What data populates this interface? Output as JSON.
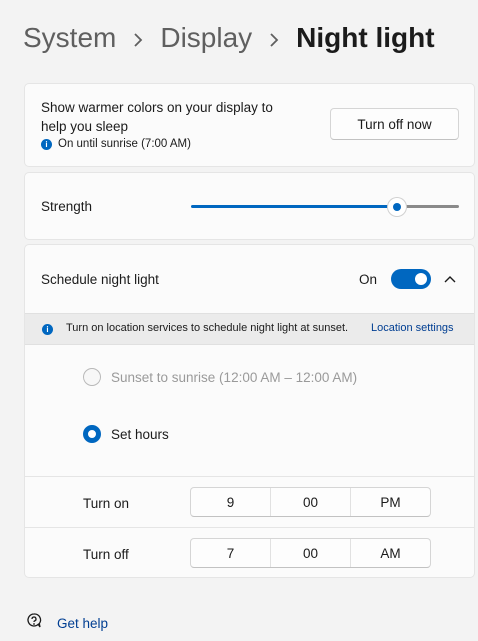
{
  "breadcrumb": {
    "items": [
      "System",
      "Display"
    ],
    "current": "Night light"
  },
  "night_light": {
    "description": "Show warmer colors on your display to help you sleep",
    "status": "On until sunrise (7:00 AM)",
    "button_label": "Turn off now"
  },
  "strength": {
    "label": "Strength",
    "value_fraction": 0.77
  },
  "schedule": {
    "label": "Schedule night light",
    "toggle_state": "On",
    "banner_text": "Turn on location services to schedule night light at sunset.",
    "banner_link": "Location settings",
    "option_sunset": "Sunset to sunrise (12:00 AM – 12:00 AM)",
    "option_set_hours": "Set hours",
    "turn_on": {
      "label": "Turn on",
      "hour": "9",
      "minute": "00",
      "period": "PM"
    },
    "turn_off": {
      "label": "Turn off",
      "hour": "7",
      "minute": "00",
      "period": "AM"
    }
  },
  "help": {
    "label": "Get help",
    "icon": "help-chat-icon"
  },
  "colors": {
    "accent": "#0067c0",
    "link": "#003e92"
  }
}
